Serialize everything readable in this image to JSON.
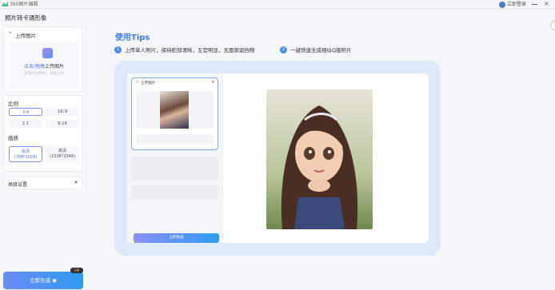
{
  "window": {
    "app_title": "360图片编辑",
    "login_label": "立即登录"
  },
  "sidebar": {
    "page_title": "照片转卡通形象",
    "upload": {
      "label": "上传图片",
      "link_text": "点击/拖拽",
      "upload_text": "上传图片",
      "hint": "支持JPG/PNG，单张上传"
    },
    "ratio": {
      "label": "比例",
      "options": [
        "3:4",
        "16:9",
        "1:1",
        "9:16"
      ],
      "selected": "3:4"
    },
    "quality": {
      "label": "画质",
      "options": [
        {
          "name": "标清",
          "size": "(768*1024)"
        },
        {
          "name": "高清",
          "size": "(1536*2048)"
        }
      ],
      "selected": "标清"
    },
    "advanced_label": "高级设置",
    "generate_label": "立即生成",
    "vip_badge": "VIP"
  },
  "main": {
    "tips_title": "使用Tips",
    "steps": [
      {
        "num": "1",
        "text": "上传单人照片，保持脸部清晰，五官明显，无面部遮挡物"
      },
      {
        "num": "2",
        "text": "一键快速生成相似Q版照片"
      }
    ],
    "demo": {
      "upload_label": "上传图片",
      "generate_label": "立即生成"
    }
  },
  "colors": {
    "accent": "#4a8af2",
    "brand_gradient_start": "#6a8bf5",
    "brand_gradient_end": "#2e9bf0",
    "demo_background": "#dde9fb"
  }
}
